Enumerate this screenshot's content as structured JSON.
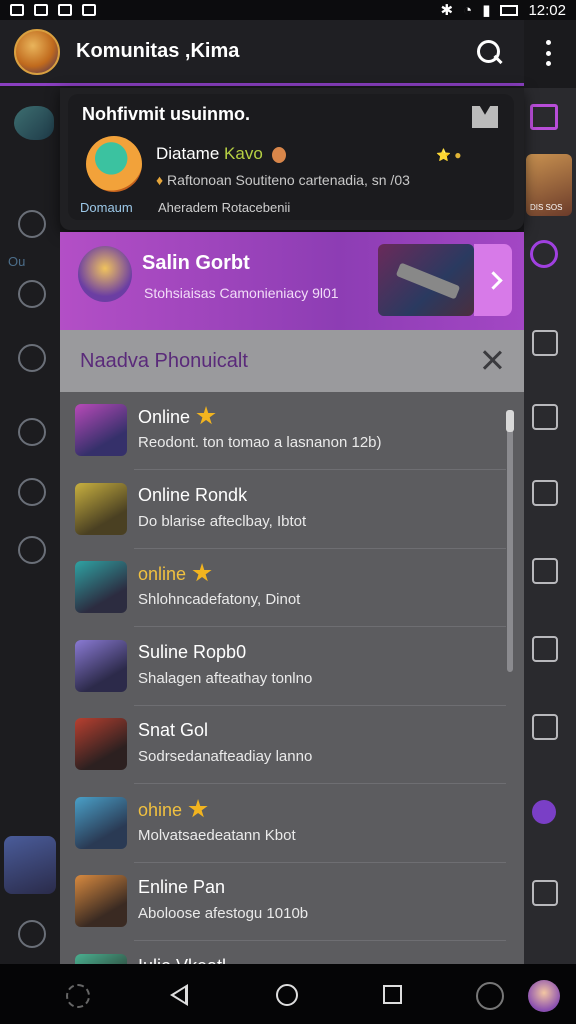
{
  "status_bar": {
    "time": "12:02"
  },
  "app_bar": {
    "title": "Komunitas ,Kima"
  },
  "left_rail": {
    "label": "Ou"
  },
  "right_rail": {
    "image_label": "DIS SOS"
  },
  "notification": {
    "heading": "Nohfivmit usuinmo.",
    "name_prefix": "Diatame",
    "name_highlight": "Kavo",
    "badge": "⭐ ●",
    "body": "Raftonoan Soutiteno cartenadia, sn /03",
    "link": "Domaum",
    "subtext": "Aheradem Rotacebenii"
  },
  "promo": {
    "title": "Salin Gorbt",
    "subtitle": "Stohsiaisas Camonieniacy 9l01"
  },
  "section": {
    "title": "Naadva Phonuicalt"
  },
  "list": [
    {
      "title": "Online",
      "star": true,
      "highlight": false,
      "subtitle": "Reodont. ton tomao a lasnanon 12b)",
      "thumb": "linear-gradient(150deg,#b84ab8,#35306a 70%)"
    },
    {
      "title": "Online Rondk",
      "star": false,
      "highlight": false,
      "subtitle": "Do blarise afteclbay, Ibtot",
      "thumb": "linear-gradient(150deg,#c8b040,#4a4022 70%)"
    },
    {
      "title": "online",
      "star": true,
      "highlight": true,
      "subtitle": "Shlohncadefatony, Dinot",
      "thumb": "linear-gradient(150deg,#2fa3a3,#2c2c40 70%)"
    },
    {
      "title": "Suline Ropb0",
      "star": false,
      "highlight": false,
      "subtitle": "Shalagen afteathay tonlno",
      "thumb": "linear-gradient(150deg,#8a7ad4,#2c2a4a 70%)"
    },
    {
      "title": "Snat Gol",
      "star": false,
      "highlight": false,
      "subtitle": "Sodrsedanafteadiay lanno",
      "thumb": "linear-gradient(150deg,#b84030,#2c2020 70%)"
    },
    {
      "title": "ohine",
      "star": true,
      "highlight": true,
      "subtitle": "Molvatsaedeatann Kbot",
      "thumb": "linear-gradient(150deg,#4aa0c8,#2a3a54 70%)"
    },
    {
      "title": "Enline Pan",
      "star": false,
      "highlight": false,
      "subtitle": "Aboloose afestogu 1010b",
      "thumb": "linear-gradient(150deg,#d88a40,#3a2a22 70%)"
    },
    {
      "title": "Iulio Vkeatl",
      "star": false,
      "highlight": false,
      "subtitle": "",
      "thumb": "linear-gradient(150deg,#4ab090,#2a3a30 70%)"
    }
  ]
}
